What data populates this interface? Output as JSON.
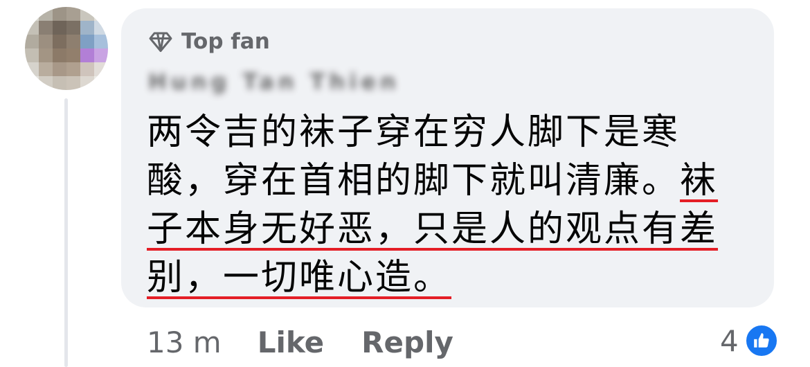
{
  "comment": {
    "badge_label": "Top fan",
    "author_name": "Hung Tan Thien",
    "text_lines": [
      {
        "plain": "两令吉的袜子穿在穷人脚下是寒",
        "underlined": ""
      },
      {
        "plain": "酸，穿在首相的脚下就叫清廉。",
        "underlined": "袜"
      },
      {
        "plain": "",
        "underlined": "子本身无好恶，只是人的观点有差"
      },
      {
        "plain": "",
        "underlined": "别，一切唯心造",
        "tail": "。"
      }
    ],
    "underline_color": "#e41e26"
  },
  "actions": {
    "timestamp": "13 m",
    "like_label": "Like",
    "reply_label": "Reply"
  },
  "reactions": {
    "count": "4",
    "icon": "thumbs-up-icon",
    "color": "#1877f2"
  },
  "colors": {
    "bubble": "#f0f2f5",
    "secondary_text": "#65676b"
  }
}
